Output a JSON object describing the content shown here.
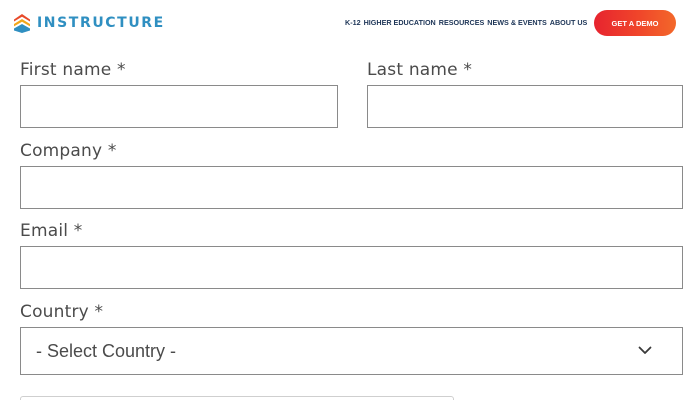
{
  "header": {
    "logo_text": "INSTRUCTURE",
    "nav": [
      "K-12",
      "HIGHER EDUCATION",
      "RESOURCES",
      "NEWS & EVENTS",
      "ABOUT US"
    ],
    "cta_label": "GET A DEMO"
  },
  "form": {
    "first_name": {
      "label": "First name *",
      "value": ""
    },
    "last_name": {
      "label": "Last name *",
      "value": ""
    },
    "company": {
      "label": "Company *",
      "value": ""
    },
    "email": {
      "label": "Email *",
      "value": ""
    },
    "country": {
      "label": "Country *",
      "selected": "- Select Country -"
    }
  },
  "colors": {
    "brand_blue": "#2f8fc1",
    "nav_text": "#1d3557",
    "cta_start": "#e7242f",
    "cta_end": "#f3682a",
    "field_border": "#8a8a8a"
  },
  "icons": {
    "logo": "instructure-chevrons-icon",
    "select_arrow": "chevron-down-icon"
  }
}
